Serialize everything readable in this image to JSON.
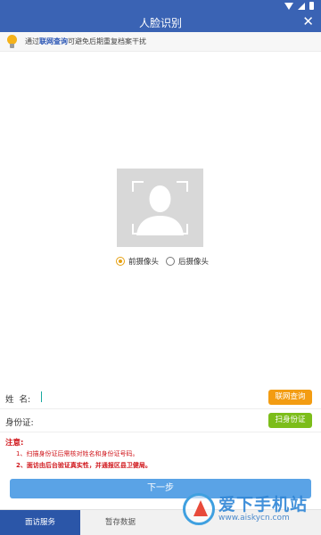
{
  "app": {
    "title": "人脸识别"
  },
  "status_bar": {
    "icons": [
      "wifi-icon",
      "signal-icon",
      "battery-icon"
    ]
  },
  "tip": {
    "prefix": "通过",
    "highlight": "联网查询",
    "suffix": "可避免后期重复档案干扰",
    "icon": "lightbulb-icon"
  },
  "photo": {
    "placeholder_icon": "face-placeholder-icon"
  },
  "camera": {
    "options": [
      {
        "label": "前摄像头",
        "selected": true
      },
      {
        "label": "后摄像头",
        "selected": false
      }
    ]
  },
  "form": {
    "name_label": "姓  名:",
    "name_value": "",
    "id_label": "身份证:",
    "id_value": "",
    "online_query_button": "联网查询",
    "scan_id_button": "扫身份证"
  },
  "notice": {
    "title": "注意:",
    "lines": [
      "1、扫描身份证后需核对姓名和身份证号码。",
      "2、面访由后台验证真实性，并通报区县卫健局。"
    ]
  },
  "next_button": "下一步",
  "tabs": [
    {
      "label": "面访服务",
      "active": true
    },
    {
      "label": "暂存数据",
      "active": false
    },
    {
      "label": "",
      "active": false
    },
    {
      "label": "",
      "active": false
    }
  ],
  "watermark": {
    "text": "爱下手机站",
    "url": "www.aiskycn.com"
  },
  "colors": {
    "primary": "#3a63b4",
    "accent_orange": "#f39c12",
    "accent_green": "#7cbd1a",
    "warning_red": "#d0161b",
    "next_button": "#5aa3e6"
  }
}
